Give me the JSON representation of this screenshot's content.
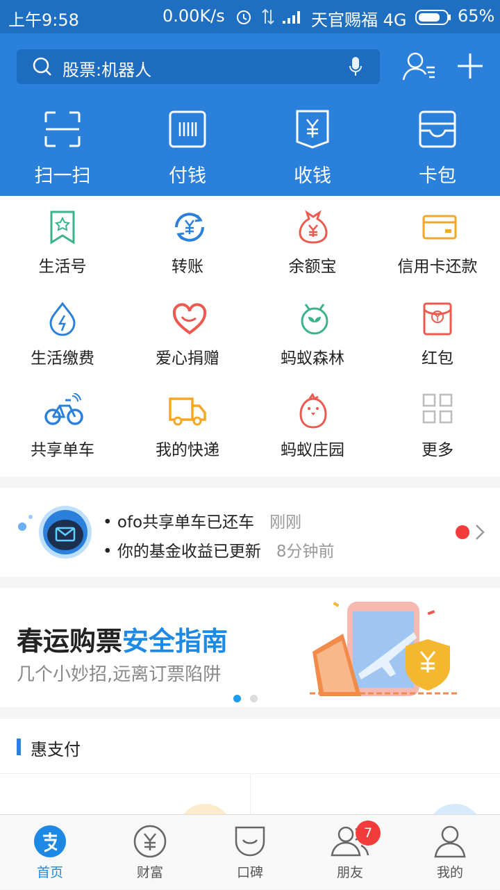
{
  "status_bar": {
    "time": "上午9:58",
    "speed": "0.00K/s",
    "carrier": "天官赐福 4G",
    "battery": "65%"
  },
  "search": {
    "placeholder": "股票:机器人"
  },
  "main_actions": [
    {
      "label": "扫一扫",
      "icon": "scan-icon"
    },
    {
      "label": "付钱",
      "icon": "pay-icon"
    },
    {
      "label": "收钱",
      "icon": "receive-icon"
    },
    {
      "label": "卡包",
      "icon": "card-wallet-icon"
    }
  ],
  "grid": [
    {
      "label": "生活号",
      "icon": "life-account-icon",
      "color": "#3bb38a"
    },
    {
      "label": "转账",
      "icon": "transfer-icon",
      "color": "#2a80db"
    },
    {
      "label": "余额宝",
      "icon": "yuebao-icon",
      "color": "#ec5a4f"
    },
    {
      "label": "信用卡还款",
      "icon": "credit-card-icon",
      "color": "#f5a623"
    },
    {
      "label": "生活缴费",
      "icon": "utility-icon",
      "color": "#2a80db"
    },
    {
      "label": "爱心捐赠",
      "icon": "donation-icon",
      "color": "#ec5a4f"
    },
    {
      "label": "蚂蚁森林",
      "icon": "forest-icon",
      "color": "#3bb38a"
    },
    {
      "label": "红包",
      "icon": "red-packet-icon",
      "color": "#ec5a4f"
    },
    {
      "label": "共享单车",
      "icon": "bike-icon",
      "color": "#2a80db"
    },
    {
      "label": "我的快递",
      "icon": "delivery-icon",
      "color": "#f5a623"
    },
    {
      "label": "蚂蚁庄园",
      "icon": "chick-icon",
      "color": "#ec5a4f"
    },
    {
      "label": "更多",
      "icon": "more-grid-icon",
      "color": "#bbbbbb"
    }
  ],
  "notifications": [
    {
      "text": "ofo共享单车已还车",
      "time": "刚刚"
    },
    {
      "text": "你的基金收益已更新",
      "time": "8分钟前"
    }
  ],
  "banner": {
    "title_a": "春运购票",
    "title_b": "安全指南",
    "subtitle": "几个小妙招,远离订票陷阱"
  },
  "section": {
    "title": "惠支付"
  },
  "tabs": [
    {
      "label": "首页",
      "icon": "home-alipay-icon",
      "active": true
    },
    {
      "label": "财富",
      "icon": "wealth-icon"
    },
    {
      "label": "口碑",
      "icon": "koubei-icon"
    },
    {
      "label": "朋友",
      "icon": "friends-icon",
      "badge": "7"
    },
    {
      "label": "我的",
      "icon": "profile-icon"
    }
  ],
  "colors": {
    "primary": "#2a80db",
    "highlight": "#1e88e5",
    "badge": "#f23b3b"
  }
}
